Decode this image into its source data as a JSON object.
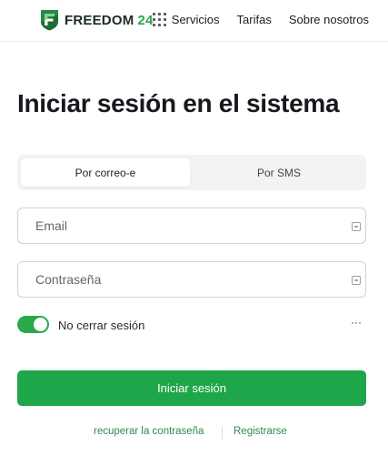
{
  "header": {
    "logo": {
      "brand": "FREEDOM",
      "number": "24",
      "icon": "freedom-shield-logo",
      "color_green": "#2aa84a"
    },
    "nav": {
      "services": "Servicios",
      "services_icon": "apps-grid-icon",
      "tariffs": "Tarifas",
      "about": "Sobre nosotros"
    }
  },
  "login": {
    "title": "Iniciar sesión en el sistema",
    "tabs": {
      "email": "Por correo-e",
      "sms": "Por SMS",
      "selected": "email"
    },
    "email_placeholder": "Email",
    "password_placeholder": "Contraseña",
    "keep_session": {
      "label": "No cerrar sesión",
      "on": true
    },
    "submit_label": "Iniciar sesión",
    "recover_link": "recuperar la contraseña",
    "register_link": "Registrarse",
    "accent_color": "#20a64a"
  }
}
